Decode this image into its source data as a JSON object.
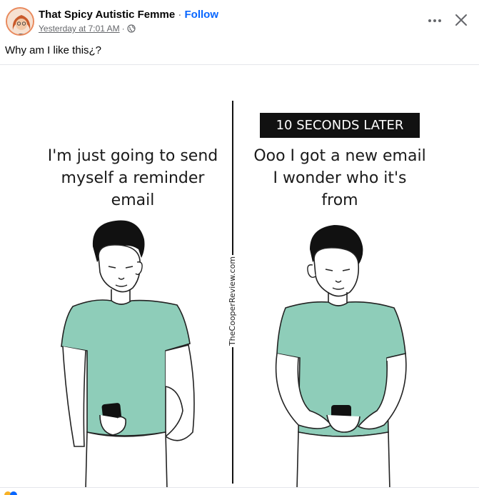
{
  "post": {
    "author": "That Spicy Autistic Femme",
    "separator": " · ",
    "follow_label": "Follow",
    "timestamp": "Yesterday at 7:01 AM",
    "meta_separator": "·",
    "privacy_icon": "globe-icon",
    "text": "Why am I like this¿?"
  },
  "header_actions": {
    "more_icon": "more-options-icon",
    "close_icon": "close-icon"
  },
  "comic": {
    "left_caption": "I'm just going to send\nmyself a reminder\nemail",
    "right_badge": "10 SECONDS LATER",
    "right_caption": "Ooo I got a new email\nI wonder who it's\nfrom",
    "watermark": "TheCooperReview.com"
  },
  "colors": {
    "follow": "#0866ff",
    "shirt": "#8ecdb9",
    "meta": "#65676b",
    "badge_bg": "#111111"
  }
}
